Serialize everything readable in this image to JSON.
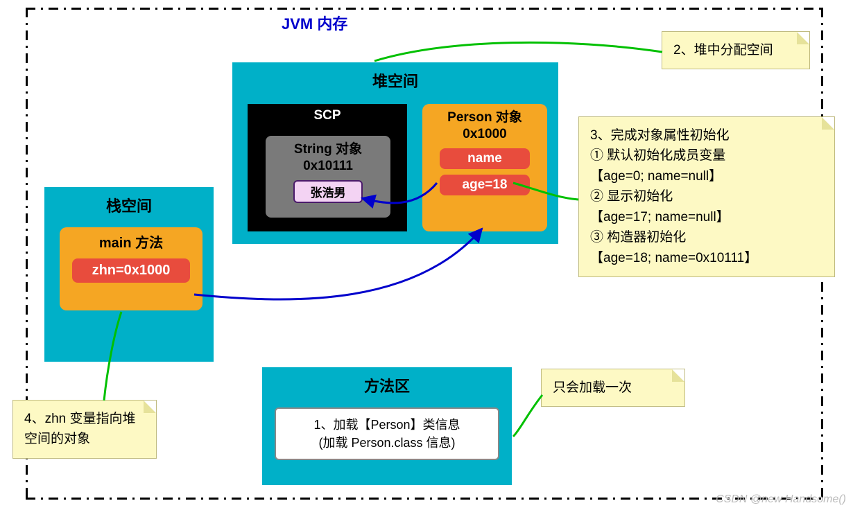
{
  "jvm_title": "JVM 内存",
  "heap": {
    "title": "堆空间",
    "scp_title": "SCP",
    "string_obj_label": "String 对象\n0x10111",
    "string_value": "张浩男",
    "person_label": "Person 对象\n0x1000",
    "person_name_field": "name",
    "person_age_field": "age=18"
  },
  "stack": {
    "title": "栈空间",
    "main_title": "main 方法",
    "zhn_var": "zhn=0x1000"
  },
  "method_area": {
    "title": "方法区",
    "class_info": "1、加载【Person】类信息\n(加载 Person.class 信息)"
  },
  "notes": {
    "n_heap": "2、堆中分配空间",
    "n_init": "3、完成对象属性初始化\n① 默认初始化成员变量\n【age=0; name=null】\n② 显示初始化\n【age=17; name=null】\n③ 构造器初始化\n【age=18; name=0x10111】",
    "n_once": "只会加载一次",
    "n_zhn": "4、zhn 变量指向堆空间的对象"
  },
  "watermark": "CSDN @new Handsome()"
}
